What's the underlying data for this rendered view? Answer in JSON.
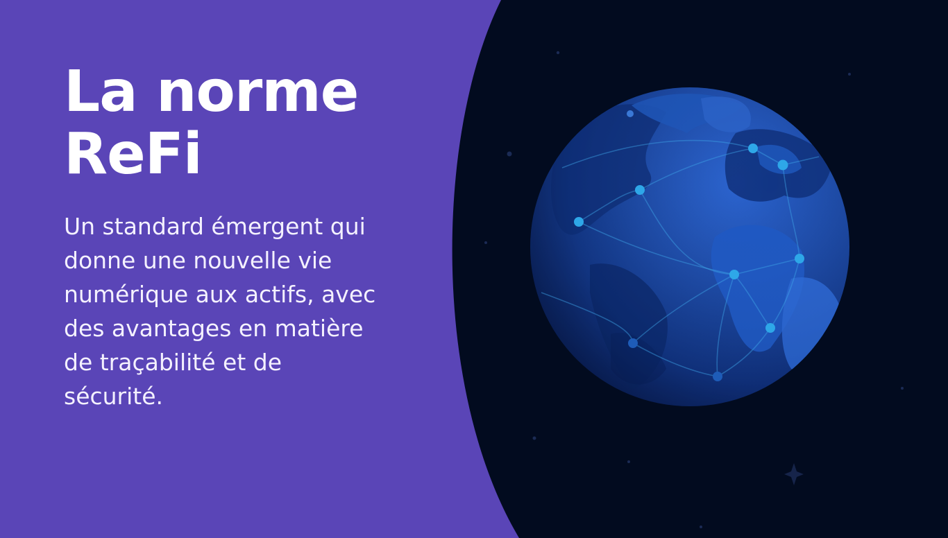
{
  "slide": {
    "title_line1": "La norme",
    "title_line2": "ReFi",
    "body_lines": [
      "Un standard émergent qui",
      "donne une nouvelle vie",
      "numérique aux actifs, avec",
      "des avantages en matière",
      "de traçabilité et de",
      "sécurité."
    ]
  },
  "theme": {
    "panel_color": "#5a45b7",
    "space_color": "#020b1f",
    "globe_blue": "#1a4aa8",
    "node_color": "#2ea7e8"
  },
  "graphics": {
    "illustration": "globe-network-illustration",
    "decoration": "sparkle-star-icon"
  }
}
